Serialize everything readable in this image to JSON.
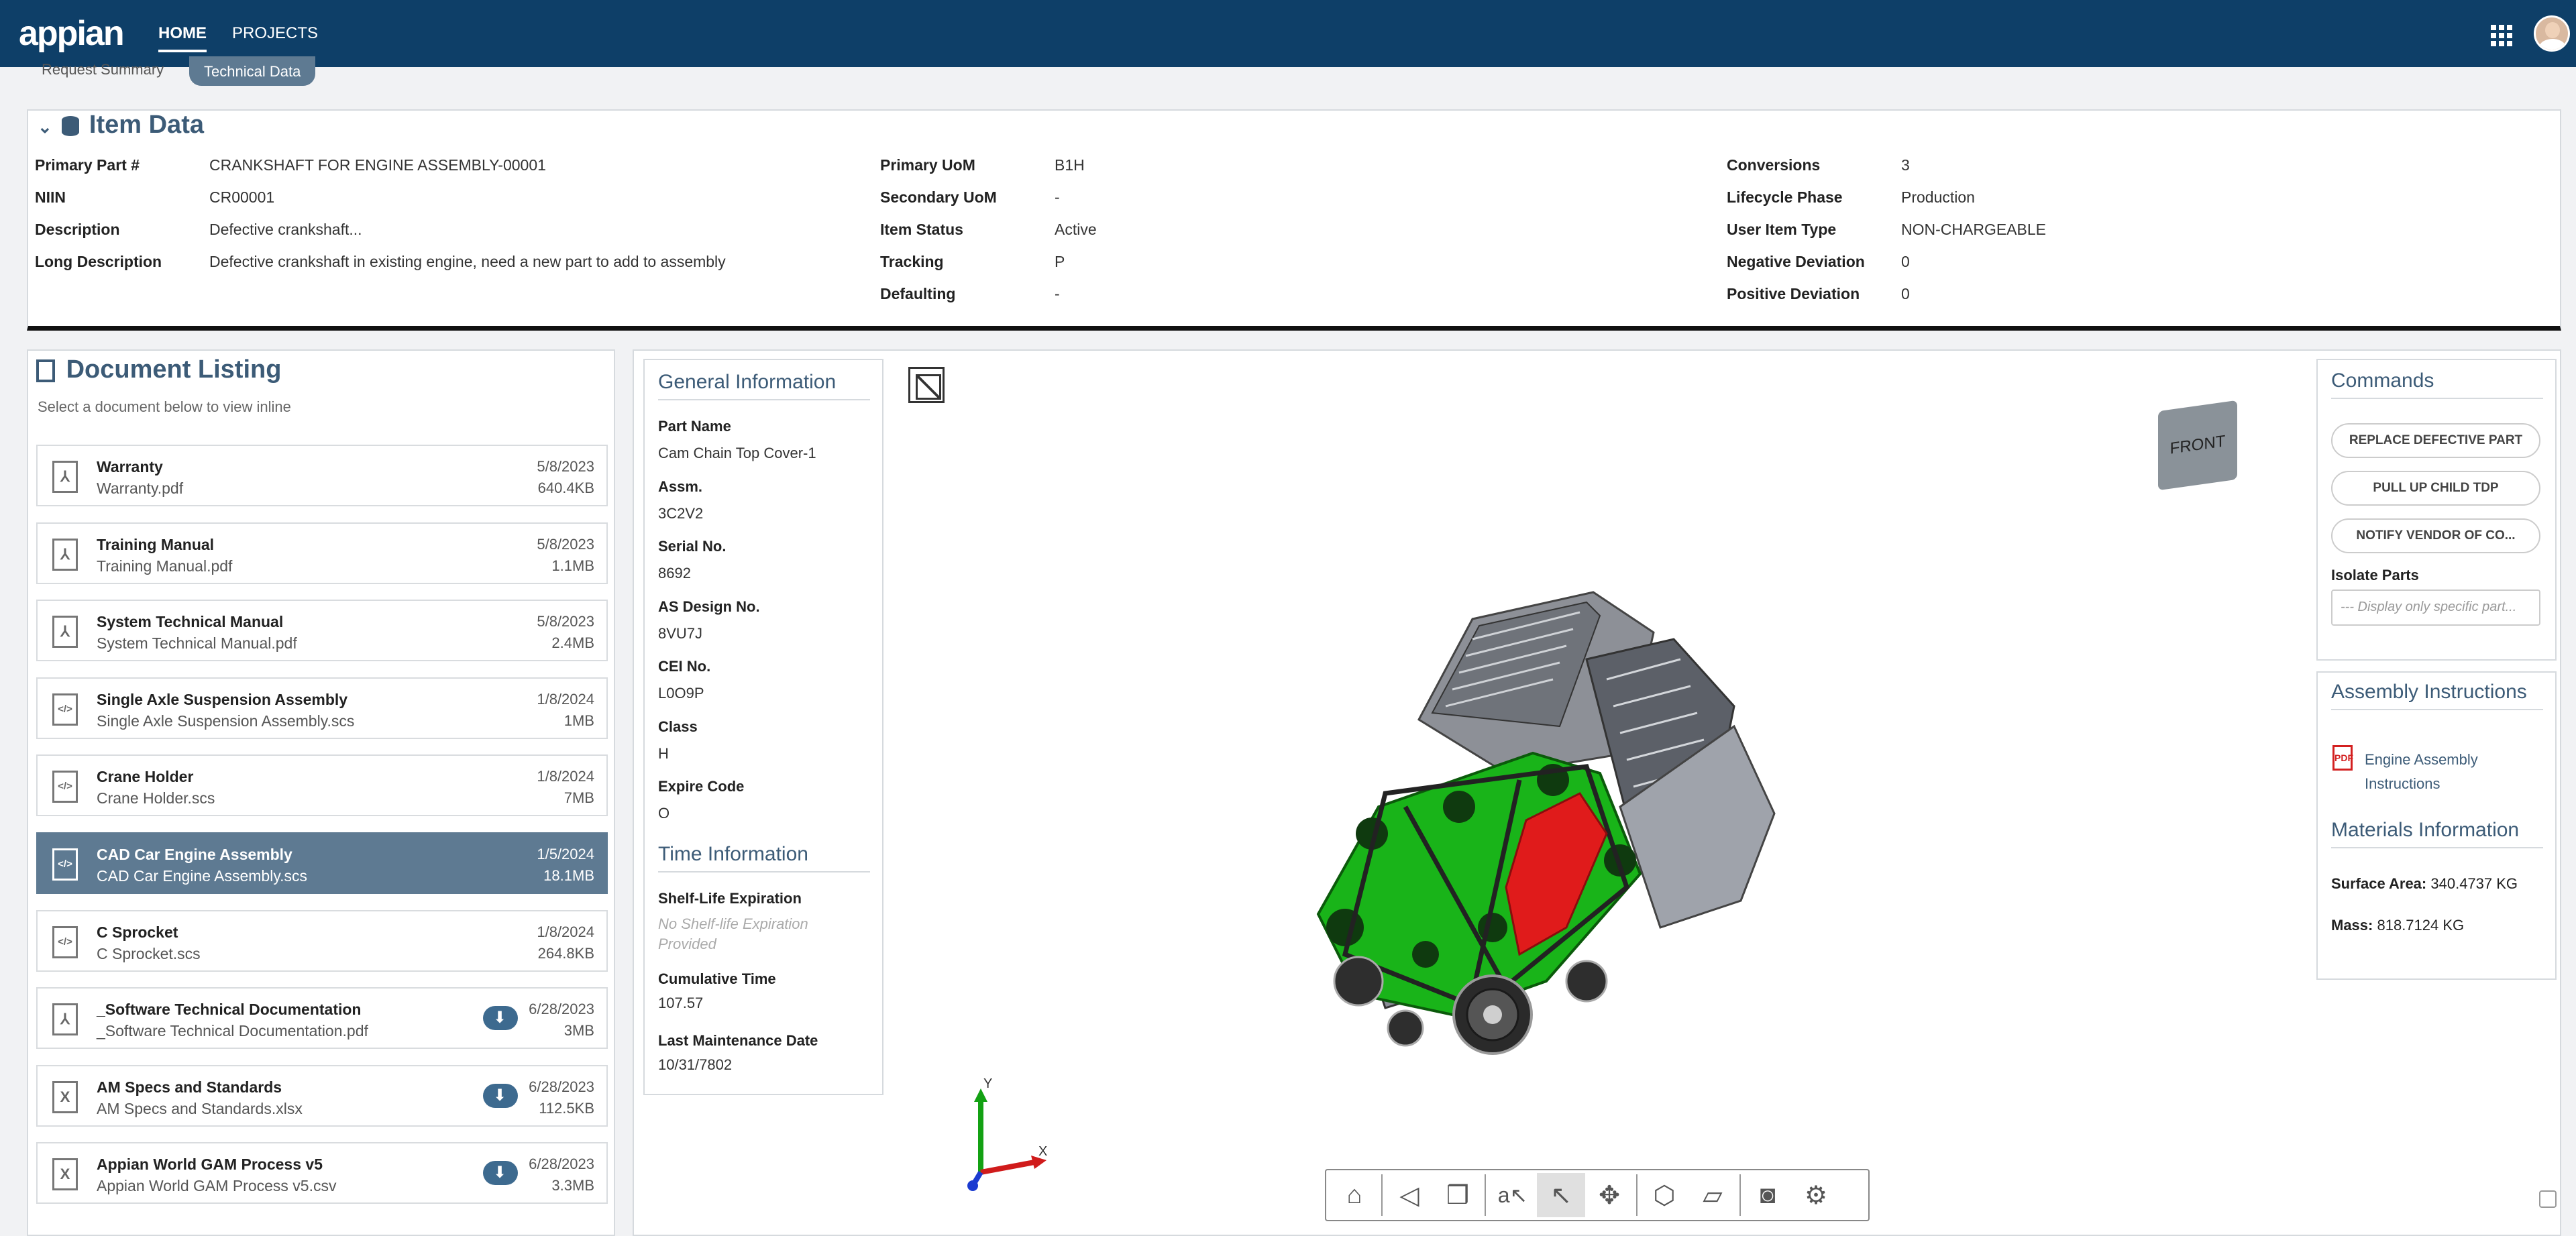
{
  "header": {
    "logo": "appian",
    "nav": [
      {
        "label": "HOME"
      },
      {
        "label": "PROJECTS"
      }
    ]
  },
  "subtabs": [
    {
      "label": "Request Summary"
    },
    {
      "label": "Technical Data"
    }
  ],
  "item_data": {
    "title": "Item Data",
    "col1": [
      {
        "label": "Primary Part #",
        "value": "CRANKSHAFT FOR ENGINE ASSEMBLY-00001"
      },
      {
        "label": "NIIN",
        "value": "CR00001"
      },
      {
        "label": "Description",
        "value": "Defective crankshaft..."
      },
      {
        "label": "Long Description",
        "value": "Defective crankshaft in existing engine, need a new part to add to assembly"
      }
    ],
    "col2": [
      {
        "label": "Primary UoM",
        "value": "B1H"
      },
      {
        "label": "Secondary UoM",
        "value": "-"
      },
      {
        "label": "Item Status",
        "value": "Active"
      },
      {
        "label": "Tracking",
        "value": "P"
      },
      {
        "label": "Defaulting",
        "value": "-"
      }
    ],
    "col3": [
      {
        "label": "Conversions",
        "value": "3"
      },
      {
        "label": "Lifecycle Phase",
        "value": "Production"
      },
      {
        "label": "User Item Type",
        "value": "NON-CHARGEABLE"
      },
      {
        "label": "Negative Deviation",
        "value": "0"
      },
      {
        "label": "Positive Deviation",
        "value": "0"
      }
    ]
  },
  "documents": {
    "title": "Document Listing",
    "subtitle": "Select a document below to view inline",
    "items": [
      {
        "name": "Warranty",
        "file": "Warranty.pdf",
        "date": "5/8/2023",
        "size": "640.4KB",
        "icon": "pdf-icon"
      },
      {
        "name": "Training Manual",
        "file": "Training Manual.pdf",
        "date": "5/8/2023",
        "size": "1.1MB",
        "icon": "pdf-icon"
      },
      {
        "name": "System Technical Manual",
        "file": "System Technical Manual.pdf",
        "date": "5/8/2023",
        "size": "2.4MB",
        "icon": "pdf-icon"
      },
      {
        "name": "Single Axle Suspension Assembly",
        "file": "Single Axle Suspension Assembly.scs",
        "date": "1/8/2024",
        "size": "1MB",
        "icon": "code-file-icon"
      },
      {
        "name": "Crane Holder",
        "file": "Crane Holder.scs",
        "date": "1/8/2024",
        "size": "7MB",
        "icon": "code-file-icon"
      },
      {
        "name": "CAD Car Engine Assembly",
        "file": "CAD Car Engine Assembly.scs",
        "date": "1/5/2024",
        "size": "18.1MB",
        "icon": "code-file-icon",
        "selected": true
      },
      {
        "name": "C Sprocket",
        "file": "C Sprocket.scs",
        "date": "1/8/2024",
        "size": "264.8KB",
        "icon": "code-file-icon"
      },
      {
        "name": "_Software Technical Documentation",
        "file": "_Software Technical Documentation.pdf",
        "date": "6/28/2023",
        "size": "3MB",
        "icon": "pdf-icon",
        "cloud": true
      },
      {
        "name": "AM Specs and Standards",
        "file": "AM Specs and Standards.xlsx",
        "date": "6/28/2023",
        "size": "112.5KB",
        "icon": "excel-icon",
        "cloud": true
      },
      {
        "name": "Appian World GAM Process v5",
        "file": "Appian World GAM Process v5.csv",
        "date": "6/28/2023",
        "size": "3.3MB",
        "icon": "excel-icon",
        "cloud": true
      }
    ]
  },
  "general_info": {
    "title": "General Information",
    "fields": [
      {
        "label": "Part Name",
        "value": "Cam Chain Top Cover-1"
      },
      {
        "label": "Assm.",
        "value": "3C2V2"
      },
      {
        "label": "Serial No.",
        "value": "8692"
      },
      {
        "label": "AS Design No.",
        "value": "8VU7J"
      },
      {
        "label": "CEI No.",
        "value": "L0O9P"
      },
      {
        "label": "Class",
        "value": "H"
      },
      {
        "label": "Expire Code",
        "value": "O"
      }
    ]
  },
  "time_info": {
    "title": "Time Information",
    "fields": [
      {
        "label": "Shelf-Life Expiration",
        "value": "No Shelf-life Expiration Provided"
      },
      {
        "label": "Cumulative Time",
        "value": "107.57"
      },
      {
        "label": "Last Maintenance Date",
        "value": "10/31/7802"
      }
    ]
  },
  "viewer": {
    "viewcube_label": "FRONT",
    "axis": {
      "x": "X",
      "y": "Y"
    },
    "toolbar": [
      "home-icon",
      "camera-view-icon",
      "cube-icon",
      "annotation-icon",
      "select-icon",
      "orbit-icon",
      "box-explode-icon",
      "section-icon",
      "snapshot-icon",
      "settings-icon"
    ],
    "highlight_color": "#19b419",
    "selected_color": "#e01b1b"
  },
  "commands": {
    "title": "Commands",
    "buttons": [
      "REPLACE DEFECTIVE PART",
      "PULL UP CHILD TDP",
      "NOTIFY VENDOR OF CO..."
    ],
    "isolate_label": "Isolate Parts",
    "isolate_placeholder": "--- Display only specific part..."
  },
  "assembly": {
    "title": "Assembly Instructions",
    "link": "Engine Assembly Instructions"
  },
  "materials": {
    "title": "Materials Information",
    "surface_label": "Surface Area:",
    "surface_value": "340.4737 KG",
    "mass_label": "Mass:",
    "mass_value": "818.7124 KG"
  }
}
